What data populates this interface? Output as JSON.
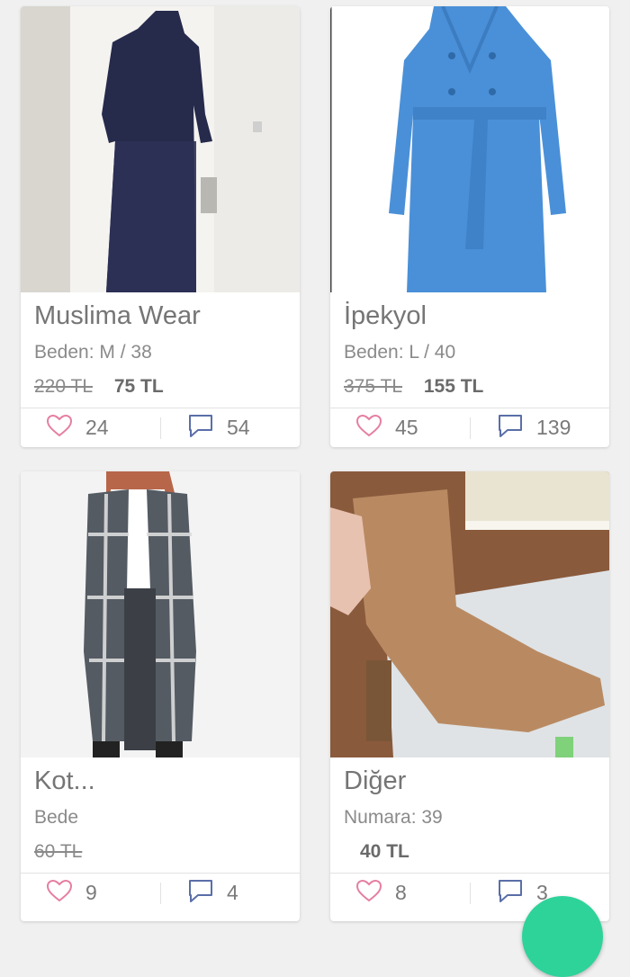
{
  "listings": [
    {
      "title": "Muslima Wear",
      "size": "Beden: M / 38",
      "old_price": "220 TL",
      "price": "75 TL",
      "likes": "24",
      "comments": "54",
      "image": "navy-dress-photo"
    },
    {
      "title": "İpekyol",
      "size": "Beden: L / 40",
      "old_price": "375 TL",
      "price": "155 TL",
      "likes": "45",
      "comments": "139",
      "image": "blue-trench-coat-photo"
    },
    {
      "title": "Kot...",
      "size": "Bede",
      "old_price": "60 TL",
      "price": "",
      "likes": "9",
      "comments": "4",
      "image": "plaid-long-cardigan-photo"
    },
    {
      "title": "Diğer",
      "size": "Numara: 39",
      "old_price": "",
      "price": "40 TL",
      "likes": "8",
      "comments": "3",
      "image": "tan-heeled-boot-photo"
    }
  ],
  "icons": {
    "like": "heart-icon",
    "comment": "comment-icon",
    "fab": "add-fab"
  },
  "colors": {
    "background": "#f0f0f0",
    "card": "#ffffff",
    "heart": "#e57fa0",
    "comment_icon": "#5a6ea8",
    "fab": "#2ed39a"
  }
}
